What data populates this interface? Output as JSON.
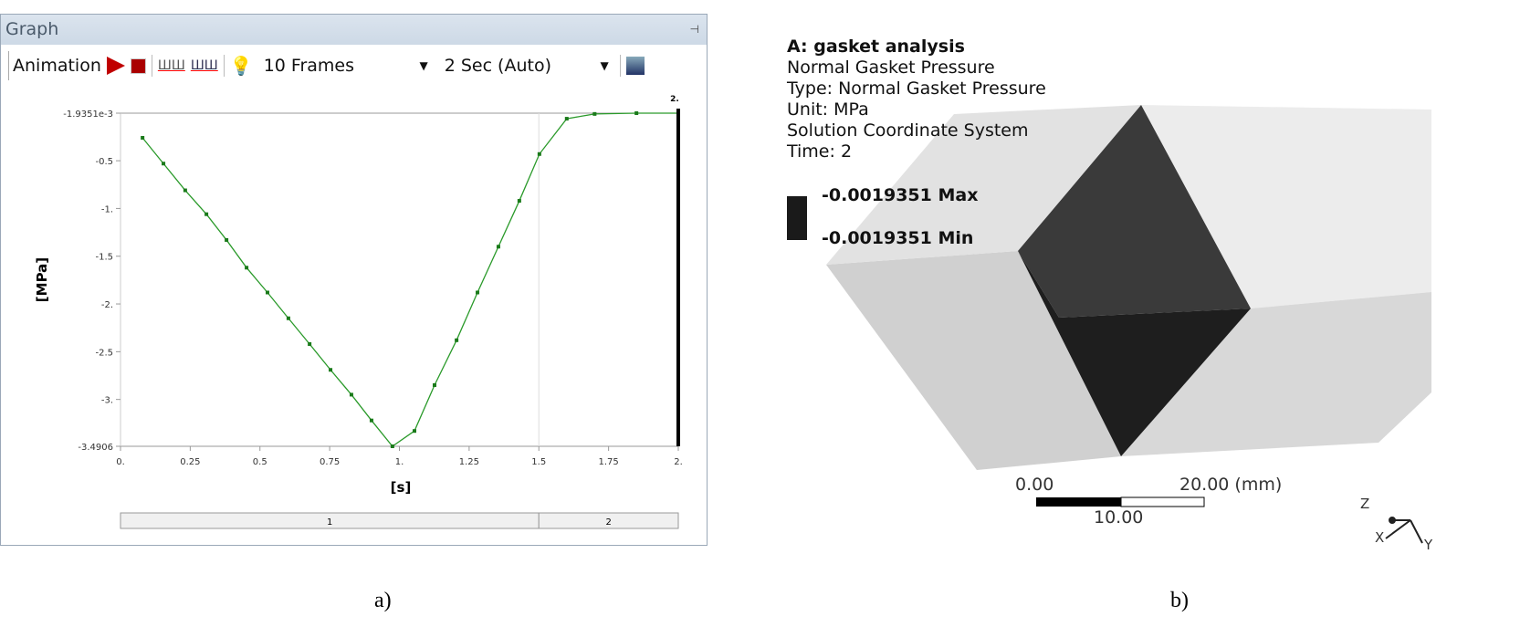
{
  "graph_panel": {
    "title": "Graph",
    "pin": "⊣",
    "toolbar": {
      "animation_label": "Animation",
      "frames": "10 Frames",
      "duration": "2 Sec (Auto)"
    },
    "x_label": "[s]",
    "y_label": "[MPa]",
    "top_marker": "2.",
    "steps": [
      "1",
      "2"
    ]
  },
  "chart_data": {
    "type": "line",
    "xlabel": "[s]",
    "ylabel": "[MPa]",
    "xlim": [
      0,
      2
    ],
    "ylim": [
      -3.4906,
      -0.0019351
    ],
    "x_ticks": [
      "0.",
      "0.25",
      "0.5",
      "0.75",
      "1.",
      "1.25",
      "1.5",
      "1.75",
      "2."
    ],
    "y_ticks": [
      {
        "v": -0.0019351,
        "label": "-1.9351e-3"
      },
      {
        "v": -0.5,
        "label": "-0.5"
      },
      {
        "v": -1,
        "label": "-1."
      },
      {
        "v": -1.5,
        "label": "-1.5"
      },
      {
        "v": -2,
        "label": "-2."
      },
      {
        "v": -2.5,
        "label": "-2.5"
      },
      {
        "v": -3,
        "label": "-3."
      },
      {
        "v": -3.4906,
        "label": "-3.4906"
      }
    ],
    "series": [
      {
        "name": "Normal Gasket Pressure",
        "color": "#2a9a2a",
        "x": [
          0.079,
          0.154,
          0.232,
          0.308,
          0.38,
          0.452,
          0.527,
          0.602,
          0.678,
          0.753,
          0.828,
          0.9,
          0.975,
          1.054,
          1.126,
          1.205,
          1.28,
          1.355,
          1.43,
          1.502,
          1.6,
          1.7,
          1.85,
          2.0
        ],
        "y": [
          -0.26,
          -0.53,
          -0.81,
          -1.06,
          -1.33,
          -1.62,
          -1.88,
          -2.15,
          -2.42,
          -2.69,
          -2.95,
          -3.22,
          -3.4906,
          -3.33,
          -2.85,
          -2.38,
          -1.88,
          -1.4,
          -0.92,
          -0.43,
          -0.06,
          -0.01,
          -0.002,
          -0.0019351
        ]
      }
    ],
    "step_boundary": 1.5,
    "current_time": 2
  },
  "result_view": {
    "title": "A: gasket analysis",
    "lines": [
      "Normal Gasket Pressure",
      "Type: Normal Gasket Pressure",
      "Unit: MPa",
      "Solution Coordinate System",
      "Time: 2"
    ],
    "max_label": "-0.0019351 Max",
    "min_label": "-0.0019351 Min",
    "scale_start": "0.00",
    "scale_end": "20.00 (mm)",
    "scale_mid": "10.00",
    "axes": {
      "z": "Z",
      "x": "X",
      "y": "Y"
    }
  },
  "captions": {
    "a": "a)",
    "b": "b)"
  }
}
